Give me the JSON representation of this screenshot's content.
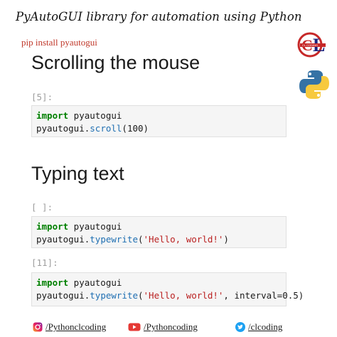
{
  "banner": {
    "title": "PyAutoGUI library for automation using Python"
  },
  "install_note": "pip install pyautogui",
  "logos": {
    "cl_text": "CL",
    "cl_subtext": "CL CODING"
  },
  "sections": [
    {
      "heading": "Scrolling the mouse"
    },
    {
      "heading": "Typing text"
    }
  ],
  "cells": [
    {
      "prompt": "[5]:",
      "line1_kw": "import",
      "line1_rest": " pyautogui",
      "line2_obj": "pyautogui.",
      "line2_fn": "scroll",
      "line2_args": "(100)"
    },
    {
      "prompt": "[ ]:",
      "line1_kw": "import",
      "line1_rest": " pyautogui",
      "line2_obj": "pyautogui.",
      "line2_fn": "typewrite",
      "line2_open": "(",
      "line2_str": "'Hello, world!'",
      "line2_close": ")"
    },
    {
      "prompt": "[11]:",
      "line1_kw": "import",
      "line1_rest": " pyautogui",
      "line2_obj": "pyautogui.",
      "line2_fn": "typewrite",
      "line2_open": "(",
      "line2_str": "'Hello, world!'",
      "line2_mid": ", interval=",
      "line2_num": "0.5",
      "line2_close": ")"
    }
  ],
  "footer": {
    "instagram": "/Pythonclcoding",
    "youtube": "/Pythoncoding",
    "twitter": "/clcoding"
  },
  "colors": {
    "keyword": "#008000",
    "function": "#1f6fb2",
    "string": "#ba2121",
    "install": "#c0392b",
    "cell_bg": "#f5f5f5"
  },
  "icons": [
    "instagram-icon",
    "youtube-icon",
    "twitter-icon",
    "clcoding-logo",
    "python-logo"
  ]
}
